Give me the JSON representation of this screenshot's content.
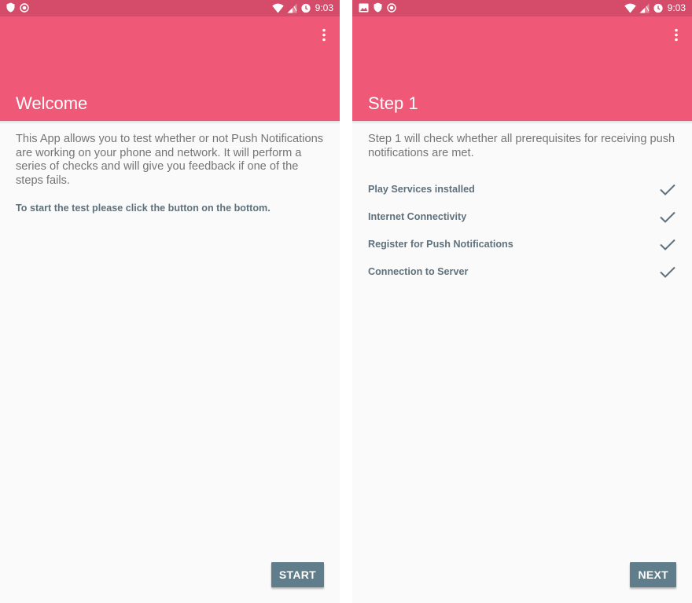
{
  "colors": {
    "status_bar": "#d44c69",
    "app_bar": "#ef5877",
    "background": "#fafafa",
    "body_text": "#757575",
    "label_text": "#5f717c",
    "button": "#607d8b",
    "check": "#5f717c"
  },
  "status_bar": {
    "time": "9:03",
    "left_icons": [
      "shield-icon",
      "record-icon",
      "image-icon"
    ],
    "right_icons": [
      "wifi-icon",
      "cell-signal-icon",
      "alarm-icon"
    ]
  },
  "screen1": {
    "title": "Welcome",
    "paragraph": "This App allows you to test whether or not Push Notifications are working on your phone and network. It will perform a series of checks and will give you feedback if one of the steps fails.",
    "bold_note": "To start the test please click the button on the bottom.",
    "button": "START"
  },
  "screen2": {
    "title": "Step 1",
    "paragraph": "Step 1 will check whether all prerequisites for receiving push notifications are met.",
    "checks": [
      {
        "label": "Play Services installed",
        "status": "done"
      },
      {
        "label": "Internet Connectivity",
        "status": "done"
      },
      {
        "label": "Register for Push Notifications",
        "status": "done"
      },
      {
        "label": "Connection to Server",
        "status": "done"
      }
    ],
    "button": "NEXT"
  }
}
